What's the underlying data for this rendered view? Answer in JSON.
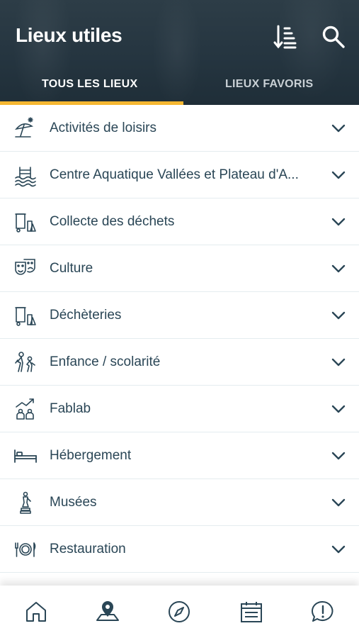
{
  "header": {
    "title": "Lieux utiles",
    "sort_icon": "sort-icon",
    "search_icon": "search-icon"
  },
  "tabs": [
    {
      "label": "TOUS LES LIEUX",
      "active": true
    },
    {
      "label": "LIEUX FAVORIS",
      "active": false
    }
  ],
  "categories": [
    {
      "label": "Activités de loisirs",
      "icon": "beach-umbrella-icon"
    },
    {
      "label": "Centre Aquatique Vallées et Plateau d'A...",
      "icon": "swimming-pool-icon"
    },
    {
      "label": "Collecte des déchets",
      "icon": "waste-bin-icon"
    },
    {
      "label": "Culture",
      "icon": "theater-masks-icon"
    },
    {
      "label": "Déchèteries",
      "icon": "waste-bin-icon"
    },
    {
      "label": "Enfance / scolarité",
      "icon": "children-icon"
    },
    {
      "label": "Fablab",
      "icon": "fablab-icon"
    },
    {
      "label": "Hébergement",
      "icon": "bed-icon"
    },
    {
      "label": "Musées",
      "icon": "statue-icon"
    },
    {
      "label": "Restauration",
      "icon": "restaurant-icon"
    }
  ],
  "bottom_nav": [
    {
      "name": "home-icon"
    },
    {
      "name": "map-pin-icon"
    },
    {
      "name": "compass-icon"
    },
    {
      "name": "calendar-icon"
    },
    {
      "name": "alert-bubble-icon"
    }
  ],
  "colors": {
    "header_bg": "#253540",
    "tab_indicator": "#f5b731",
    "text": "#2a4656",
    "divider": "#e4ecef"
  }
}
